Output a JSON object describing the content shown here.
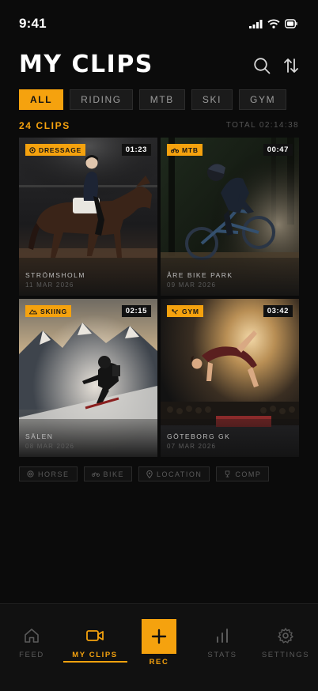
{
  "status_bar": {
    "time": "9:41"
  },
  "header": {
    "title": "MY CLIPS",
    "search_icon": "search-icon",
    "sort_icon": "sort-icon"
  },
  "filters": [
    "ALL",
    "RIDING",
    "MTB",
    "SKI",
    "GYM"
  ],
  "active_filter": "ALL",
  "summary": {
    "count": "24 CLIPS",
    "total": "TOTAL 02:14:38"
  },
  "clips": [
    {
      "tag": "DRESSAGE",
      "tag_icon": "target-icon",
      "duration": "01:23",
      "location": "STRÖMSHOLM",
      "date": "11 MAR 2026"
    },
    {
      "tag": "MTB",
      "tag_icon": "bike-icon",
      "duration": "00:47",
      "location": "ÅRE BIKE PARK",
      "date": "09 MAR 2026"
    },
    {
      "tag": "SKIING",
      "tag_icon": "mountain-icon",
      "duration": "02:15",
      "location": "SÄLEN",
      "date": "08 MAR 2026"
    },
    {
      "tag": "GYM",
      "tag_icon": "gymnast-icon",
      "duration": "03:42",
      "location": "GÖTEBORG GK",
      "date": "07 MAR 2026"
    }
  ],
  "secondary_tags": [
    {
      "label": "HORSE",
      "icon": "horse-icon"
    },
    {
      "label": "BIKE",
      "icon": "bike-icon"
    },
    {
      "label": "LOCATION",
      "icon": "pin-icon"
    },
    {
      "label": "COMP",
      "icon": "trophy-icon"
    }
  ],
  "nav": {
    "feed": "FEED",
    "my_clips": "MY CLIPS",
    "rec": "REC",
    "stats": "STATS",
    "settings": "SETTINGS"
  },
  "colors": {
    "accent": "#f5a20e",
    "background": "#0b0b0b"
  }
}
